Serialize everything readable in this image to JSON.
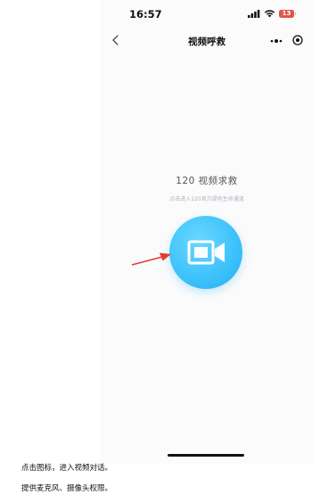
{
  "status_bar": {
    "time": "16:57",
    "battery": "13"
  },
  "nav": {
    "title": "视频呼救"
  },
  "content": {
    "title": "120 视频求救",
    "subtitle": "点击进入120官方绿色生命通道"
  },
  "captions": {
    "line1": "点击图标，进入视频对话。",
    "line2": "提供麦克风、摄像头权限。"
  },
  "colors": {
    "accent": "#3fc3fb",
    "arrow": "#e53935",
    "battery": "#e2544c"
  },
  "icons": [
    "back-icon",
    "more-icon",
    "target-icon",
    "video-camera-icon",
    "signal-icon",
    "wifi-icon",
    "battery-icon"
  ]
}
